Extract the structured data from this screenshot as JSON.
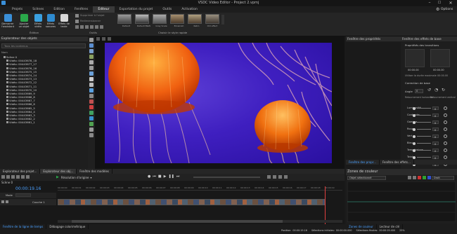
{
  "window": {
    "title": "VSDC Video Editor - Project 2.vpmj"
  },
  "menu": {
    "tabs": [
      "Projets",
      "Scènes",
      "Edition",
      "Fenêtres",
      "Éditeur",
      "Exportation du projet",
      "Outils",
      "Activation"
    ],
    "active": "Éditeur",
    "options_label": "Options"
  },
  "ribbon": {
    "buttons": [
      {
        "label": "Demarrer l'assistant",
        "icon": "wizard-icon",
        "color": "#3a8fd8"
      },
      {
        "label": "Ajouter un objet",
        "icon": "add-object-icon",
        "color": "#2aa84a"
      },
      {
        "label": "Effets vidéo",
        "icon": "video-effects-icon",
        "color": "#3aa0e0"
      },
      {
        "label": "Effets sonores",
        "icon": "audio-effects-icon",
        "color": "#2e8bd0"
      },
      {
        "label": "Effets de texte",
        "icon": "text-effects-icon",
        "color": "#d8d8d8"
      }
    ],
    "group_edition": "Édition",
    "group_outils": "Outils",
    "tools_items": [
      "Supprimer à l'objet",
      "Redimensionner"
    ],
    "style_label": "Choisir le style rapide",
    "style_names": [
      "Default",
      "Default B&W",
      "Gray Scale",
      "Brownish",
      "Retro",
      "Old effect"
    ]
  },
  "objects": {
    "title": "Explorateur des objets",
    "search_placeholder": "Tous les contenus",
    "column": "Nom",
    "scene": "Scène 0",
    "items": [
      "Vidéo: 00443678_18",
      "Vidéo: 00443677_17",
      "Vidéo: 00443676_16",
      "Vidéo: 00443675_15",
      "Vidéo: 00443674_14",
      "Vidéo: 00443673_13",
      "Vidéo: 00443672_12",
      "Vidéo: 00443671_11",
      "Vidéo: 00443670_10",
      "Vidéo: 00443669_9",
      "Vidéo: 00443668_8",
      "Vidéo: 00443667_7",
      "Vidéo: 00443666_6",
      "Vidéo: 00443665_5",
      "Vidéo: 00443664_4",
      "Vidéo: 00443663_3",
      "Vidéo: 00443662_2",
      "Vidéo: 00443661_1"
    ]
  },
  "properties": {
    "title": "Fenêtre des propriétés",
    "effects_title": "Fenêtre des effets de base",
    "transitions_label": "Propriétés des transitions",
    "time_left": "00:00.00",
    "time_right": "00:00.00",
    "dur_label": "Utiliser la durée maximale",
    "dur_value": "00:00.00",
    "base_label": "Correction de base",
    "angle_label": "Angle",
    "angle_value": "0",
    "flip_h": "Retournement horizontal",
    "flip_v": "Retournement vertical",
    "sliders": [
      {
        "name": "Luminosité",
        "value": "0"
      },
      {
        "name": "Contraste",
        "value": "0"
      },
      {
        "name": "Gamma",
        "value": "0"
      },
      {
        "name": "Rouge",
        "value": "0"
      },
      {
        "name": "Vert",
        "value": "0"
      },
      {
        "name": "Bleu",
        "value": "0"
      },
      {
        "name": "Température",
        "value": "0"
      },
      {
        "name": "Teinte",
        "value": "0"
      },
      {
        "name": "Saturation",
        "value": "0"
      }
    ]
  },
  "bottom_tabs": [
    "Explorateur des projet...",
    "Explorateur des obj...",
    "Fenêtre des modèles"
  ],
  "right_bottom_tabs": [
    "Fenêtre des propr...",
    "Fenêtre des effets..."
  ],
  "timeline": {
    "resolution_label": "Résolution d'origine",
    "time": "00:00:19.16",
    "track_label": "Scène 0",
    "layer_name": "Couche 1",
    "layer_tag": "Mode",
    "ruler": [
      "00:00:00",
      "00:00:01",
      "00:00:02",
      "00:00:03",
      "00:00:04",
      "00:00:05",
      "00:00:06",
      "00:00:07",
      "00:00:08",
      "00:00:09",
      "00:00:10",
      "00:00:11",
      "00:00:12",
      "00:00:13",
      "00:00:14",
      "00:00:15",
      "00:00:16",
      "00:00:17",
      "00:00:18",
      "00:00:19"
    ]
  },
  "color_zone": {
    "title": "Zones de couleur",
    "object_select": "Objet sélectionné",
    "mode": "Droit"
  },
  "status": {
    "tabs": [
      "Fenêtre de la ligne de temps",
      "Débogage colorimétrique"
    ],
    "position_label": "Position:",
    "position": "00:00:19.16",
    "sel_label": "Sélections initiales:",
    "sel": "00:00:00.000",
    "sel_end_label": "Sélections finales:",
    "sel_end": "00:00:19.400",
    "zoom": "25%",
    "right_tabs": [
      "Zones de couleur",
      "Lecteur de clé"
    ]
  }
}
